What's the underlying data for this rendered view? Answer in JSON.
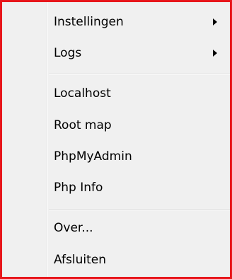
{
  "menu": {
    "items": [
      {
        "label": "Instellingen",
        "submenu": true
      },
      {
        "label": "Logs",
        "submenu": true
      },
      {
        "label": "Localhost",
        "submenu": false
      },
      {
        "label": "Root map",
        "submenu": false
      },
      {
        "label": "PhpMyAdmin",
        "submenu": false
      },
      {
        "label": "Php Info",
        "submenu": false
      },
      {
        "label": "Over...",
        "submenu": false
      },
      {
        "label": "Afsluiten",
        "submenu": false
      }
    ]
  },
  "colors": {
    "border": "#e8161b",
    "background": "#f0f0f0",
    "separator": "#dcdcdc",
    "text": "#000000"
  },
  "icons": {
    "submenu": "submenu-arrow-icon"
  }
}
